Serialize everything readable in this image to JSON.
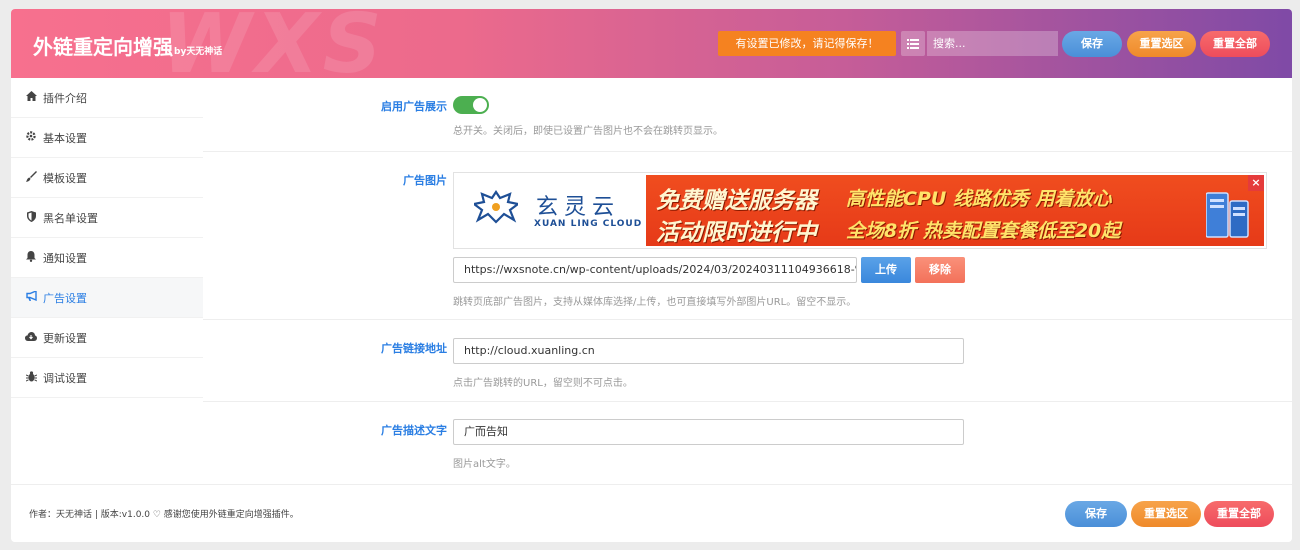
{
  "header": {
    "title": "外链重定向增强",
    "title_by": "by天无神话",
    "watermark": "WXS",
    "notice": "有设置已修改，请记得保存！",
    "search_placeholder": "搜索...",
    "save_label": "保存",
    "reset_section_label": "重置选区",
    "reset_all_label": "重置全部"
  },
  "sidebar": {
    "items": [
      {
        "label": "插件介绍",
        "icon": "home-icon"
      },
      {
        "label": "基本设置",
        "icon": "gear-icon"
      },
      {
        "label": "模板设置",
        "icon": "brush-icon"
      },
      {
        "label": "黑名单设置",
        "icon": "shield-icon"
      },
      {
        "label": "通知设置",
        "icon": "bell-icon"
      },
      {
        "label": "广告设置",
        "icon": "bullhorn-icon",
        "active": true
      },
      {
        "label": "更新设置",
        "icon": "cloud-download-icon"
      },
      {
        "label": "调试设置",
        "icon": "bug-icon"
      }
    ]
  },
  "settings": {
    "enable_ad": {
      "label": "启用广告展示",
      "enabled": true,
      "desc": "总开关。关闭后，即使已设置广告图片也不会在跳转页显示。"
    },
    "ad_image": {
      "label": "广告图片",
      "url": "https://wxsnote.cn/wp-content/uploads/2024/03/20240311104936618-%",
      "upload_label": "上传",
      "remove_label": "移除",
      "desc": "跳转页底部广告图片，支持从媒体库选择/上传，也可直接填写外部图片URL。留空不显示。",
      "banner": {
        "logo_cn": "玄灵云",
        "logo_en": "XUAN LING CLOUD",
        "line1_big": "免费赠送服务器",
        "line1_small": "高性能CPU 线路优秀 用着放心",
        "line2_big": "活动限时进行中",
        "line2_small": "全场8折 热卖配置套餐低至20起",
        "close": "×"
      }
    },
    "ad_link": {
      "label": "广告链接地址",
      "value": "http://cloud.xuanling.cn",
      "desc": "点击广告跳转的URL，留空则不可点击。"
    },
    "ad_alt": {
      "label": "广告描述文字",
      "value": "广而告知",
      "desc": "图片alt文字。"
    }
  },
  "footer": {
    "text": "作者：天无神话 | 版本:v1.0.0 ♡ 感谢您使用外链重定向增强插件。",
    "save_label": "保存",
    "reset_section_label": "重置选区",
    "reset_all_label": "重置全部"
  },
  "colors": {
    "accent": "#2a7ee3",
    "toggle_on": "#4caf50",
    "notice": "#f58220",
    "save": "#4a8fd8",
    "reset_section": "#ef8a2a",
    "reset_all": "#ee4c5c",
    "remove": "#f7826b"
  }
}
